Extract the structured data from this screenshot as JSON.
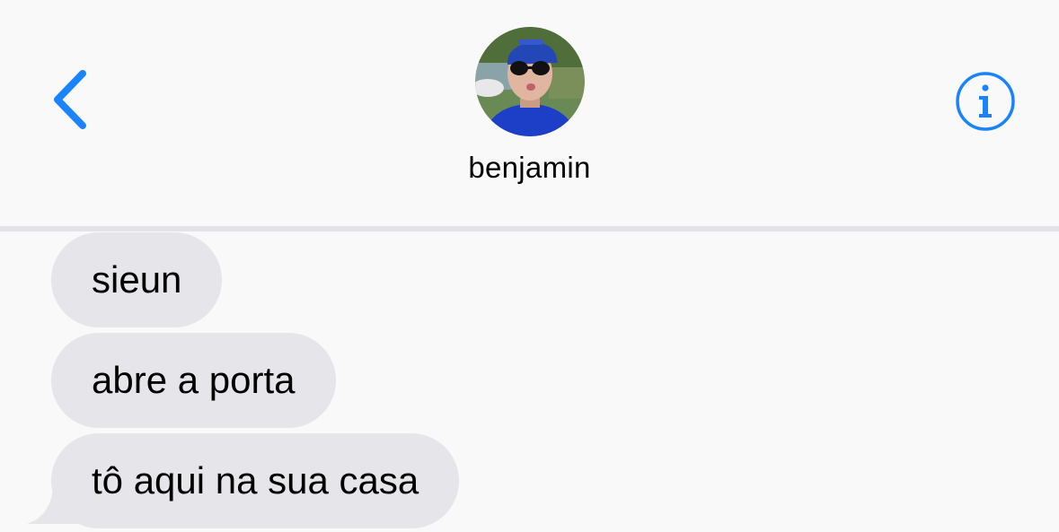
{
  "header": {
    "contact_name": "benjamin",
    "back_icon": "chevron-left-icon",
    "info_icon": "info-circle-icon",
    "accent_color": "#1a84ff"
  },
  "messages": [
    {
      "text": "sieun",
      "direction": "received"
    },
    {
      "text": "abre a porta",
      "direction": "received"
    },
    {
      "text": "tô aqui na sua casa",
      "direction": "received"
    }
  ],
  "colors": {
    "background": "#f9f9f9",
    "received_bubble": "#e5e5ea",
    "divider": "#e3e3e8"
  }
}
